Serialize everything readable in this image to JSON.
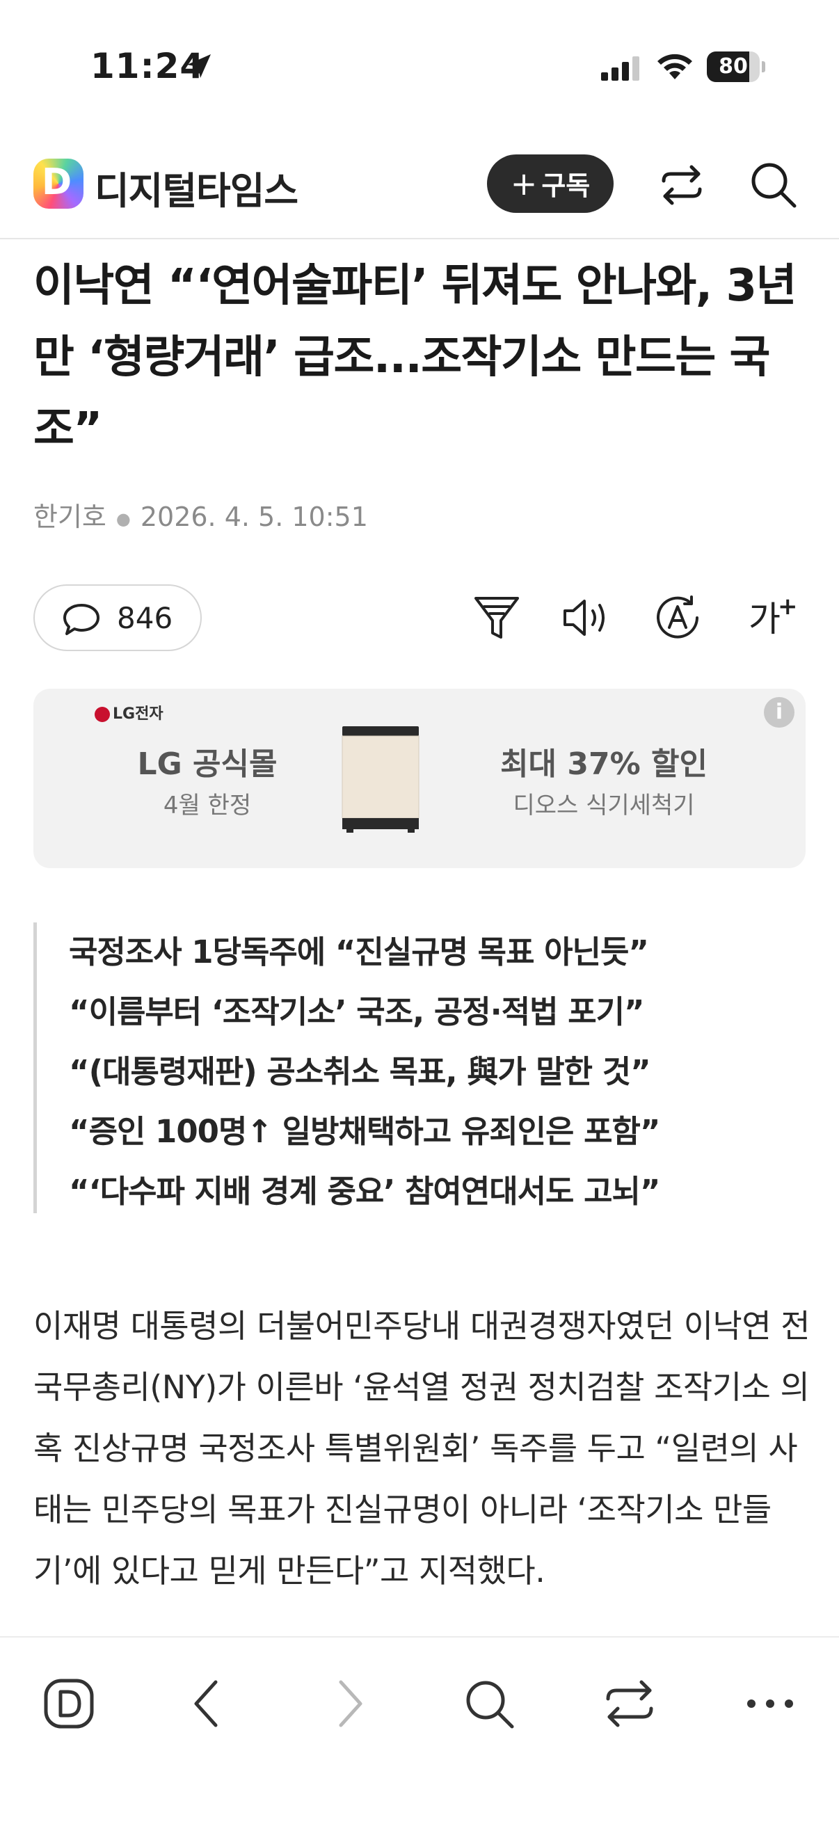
{
  "status_bar": {
    "time": "11:24",
    "battery": "80",
    "battery_level": 0.8
  },
  "header": {
    "brand": "디지털타임스",
    "logo_letter": "D",
    "subscribe_plus": "+",
    "subscribe_label": "구독"
  },
  "article": {
    "headline": "이낙연 “‘연어술파티’ 뒤져도 안나와, 3년만 ‘형량거래’ 급조...조작기소 만드는 국조”",
    "author": "한기호",
    "date": "2026. 4. 5. 10:51",
    "comment_count": "846",
    "font_size_label": "가",
    "font_size_plus": "+",
    "summary": [
      "국정조사 1당독주에 “진실규명 목표 아닌듯”",
      "“이름부터 ‘조작기소’ 국조, 공정·적법 포기”",
      "“(대통령재판) 공소취소 목표, 與가 말한 것”",
      "“증인 100명↑ 일방채택하고 유죄인은 포함”",
      "“‘다수파 지배 경계 중요’ 참여연대서도 고뇌”"
    ],
    "body": "이재명 대통령의 더불어민주당내 대권경쟁자였던 이낙연 전 국무총리(NY)가 이른바 ‘윤석열 정권 정치검찰 조작기소 의혹 진상규명 국정조사 특별위원회’ 독주를 두고 “일련의 사태는 민주당의 목표가 진실규명이 아니라 ‘조작기소 만들기’에 있다고 믿게 만든다”고 지적했다."
  },
  "ad": {
    "brand_badge": "LG전자",
    "info": "i",
    "left_title": "LG 공식몰",
    "left_sub": "4월 한정",
    "right_title": "최대 37% 할인",
    "right_sub": "디오스 식기세척기"
  },
  "bottom_nav": {
    "items": [
      "app-home-icon",
      "back-icon",
      "forward-icon",
      "search-icon",
      "share-icon",
      "more-icon"
    ]
  }
}
